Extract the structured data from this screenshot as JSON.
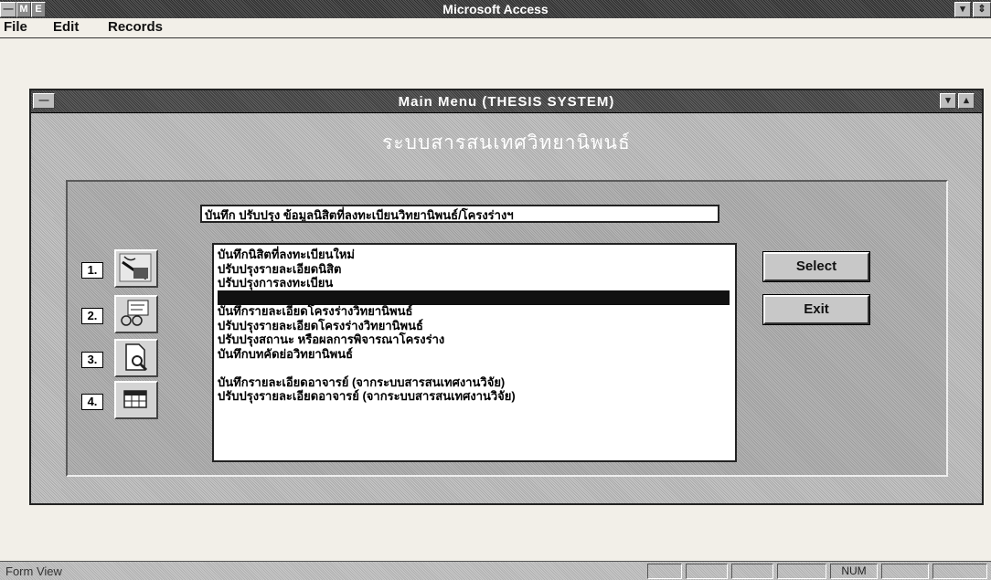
{
  "app": {
    "title": "Microsoft Access",
    "control_menu_icon": "control-menu-icon",
    "app_icon_glyph": "M",
    "app_icon2_glyph": "E"
  },
  "menubar": {
    "items": [
      {
        "label": "File"
      },
      {
        "label": "Edit"
      },
      {
        "label": "Records"
      }
    ]
  },
  "main_window": {
    "title": "Main  Menu  (THESIS SYSTEM)",
    "heading": "ระบบสารสนเทศวิทยานิพนธ์"
  },
  "form": {
    "caption": "บันทึก ปรับปรุง ข้อมูลนิสิตที่ลงทะเบียนวิทยานิพนธ์/โครงร่างฯ",
    "numbers": [
      "1.",
      "2.",
      "3.",
      "4."
    ],
    "icons": [
      "edit-pen-icon",
      "form-icon",
      "preview-icon",
      "table-icon"
    ],
    "list_items": [
      "บันทึกนิสิตที่ลงทะเบียนใหม่",
      "ปรับปรุงรายละเอียดนิสิต",
      "ปรับปรุงการลงทะเบียน",
      "",
      "บันทึกรายละเอียดโครงร่างวิทยานิพนธ์",
      "ปรับปรุงรายละเอียดโครงร่างวิทยานิพนธ์",
      "ปรับปรุงสถานะ หรือผลการพิจารณาโครงร่าง",
      "บันทึกบทคัดย่อวิทยานิพนธ์",
      "",
      "บันทึกรายละเอียดอาจารย์ (จากระบบสารสนเทศงานวิจัย)",
      "ปรับปรุงรายละเอียดอาจารย์ (จากระบบสารสนเทศงานวิจัย)"
    ],
    "selected_index": 3,
    "select_label": "Select",
    "exit_label": "Exit"
  },
  "status": {
    "text": "Form View",
    "num_indicator": "NUM"
  }
}
